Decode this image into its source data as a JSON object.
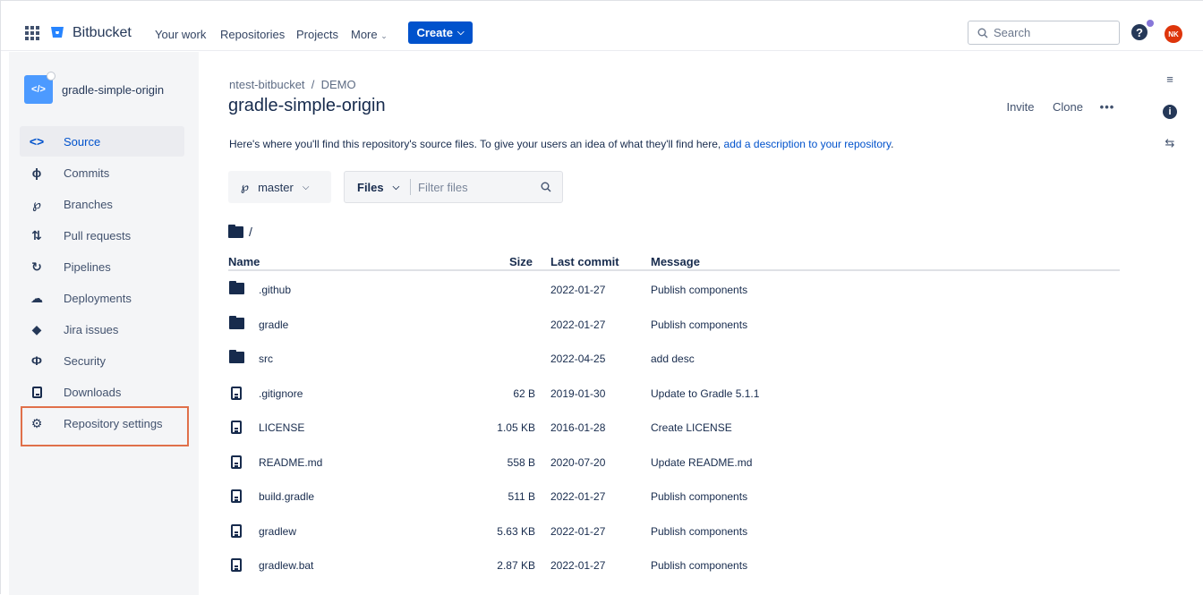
{
  "nav": {
    "brand": "Bitbucket",
    "links": [
      "Your work",
      "Repositories",
      "Projects",
      "More"
    ],
    "create_label": "Create",
    "search_placeholder": "Search",
    "avatar_initials": "NK"
  },
  "sidebar": {
    "repo_name": "gradle-simple-origin",
    "items": [
      {
        "label": "Source",
        "icon": "code-icon",
        "active": true
      },
      {
        "label": "Commits",
        "icon": "commit-icon"
      },
      {
        "label": "Branches",
        "icon": "branch-icon"
      },
      {
        "label": "Pull requests",
        "icon": "pull-request-icon"
      },
      {
        "label": "Pipelines",
        "icon": "pipelines-icon"
      },
      {
        "label": "Deployments",
        "icon": "cloud-upload-icon"
      },
      {
        "label": "Jira issues",
        "icon": "jira-icon"
      },
      {
        "label": "Security",
        "icon": "shield-icon"
      },
      {
        "label": "Downloads",
        "icon": "file-icon"
      },
      {
        "label": "Repository settings",
        "icon": "gear-icon"
      }
    ]
  },
  "header": {
    "breadcrumb": "ntest-bitbucket  /  DEMO",
    "title": "gradle-simple-origin",
    "invite_label": "Invite",
    "clone_label": "Clone",
    "more_label": "•••"
  },
  "description": {
    "text": "Here's where you'll find this repository's source files. To give your users an idea of what they'll find here, ",
    "link": "add a description to your repository",
    "suffix": "."
  },
  "controls": {
    "branch": "master",
    "files_label": "Files",
    "filter_placeholder": "Filter files"
  },
  "path": "/",
  "table": {
    "headers": {
      "name": "Name",
      "size": "Size",
      "last_commit": "Last commit",
      "message": "Message"
    },
    "rows": [
      {
        "type": "folder",
        "name": ".github",
        "size": "",
        "date": "2022-01-27",
        "message": "Publish components"
      },
      {
        "type": "folder",
        "name": "gradle",
        "size": "",
        "date": "2022-01-27",
        "message": "Publish components"
      },
      {
        "type": "folder",
        "name": "src",
        "size": "",
        "date": "2022-04-25",
        "message": "add desc"
      },
      {
        "type": "file",
        "name": ".gitignore",
        "size": "62 B",
        "date": "2019-01-30",
        "message": "Update to Gradle 5.1.1"
      },
      {
        "type": "file",
        "name": "LICENSE",
        "size": "1.05 KB",
        "date": "2016-01-28",
        "message": "Create LICENSE"
      },
      {
        "type": "file",
        "name": "README.md",
        "size": "558 B",
        "date": "2020-07-20",
        "message": "Update README.md"
      },
      {
        "type": "file",
        "name": "build.gradle",
        "size": "511 B",
        "date": "2022-01-27",
        "message": "Publish components"
      },
      {
        "type": "file",
        "name": "gradlew",
        "size": "5.63 KB",
        "date": "2022-01-27",
        "message": "Publish components"
      },
      {
        "type": "file",
        "name": "gradlew.bat",
        "size": "2.87 KB",
        "date": "2022-01-27",
        "message": "Publish components"
      }
    ]
  },
  "colors": {
    "accent": "#0052cc",
    "highlight": "#e0704a",
    "sidebar_bg": "#f4f5f7"
  }
}
